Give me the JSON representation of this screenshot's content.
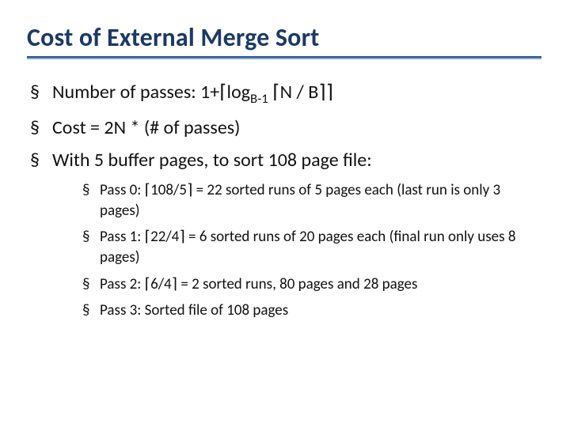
{
  "title": "Cost of External Merge Sort",
  "bullets": [
    {
      "text": "Number of passes:  1+⌈log",
      "sub": "B-1",
      "text2": " ⌈N / B⌉⌉"
    },
    {
      "text": "Cost = 2N * (# of passes)"
    },
    {
      "text": "With 5 buffer pages, to sort 108 page file:"
    }
  ],
  "sub_bullets": [
    "Pass 0:  ⌈108/5⌉ = 22 sorted runs of 5 pages each (last run is only 3 pages)",
    "Pass 1: ⌈22/4⌉ = 6 sorted runs of 20 pages each (final run only uses 8 pages)",
    "Pass 2: ⌈6/4⌉ = 2 sorted runs, 80 pages and 28 pages",
    "Pass 3:  Sorted file of 108 pages"
  ]
}
